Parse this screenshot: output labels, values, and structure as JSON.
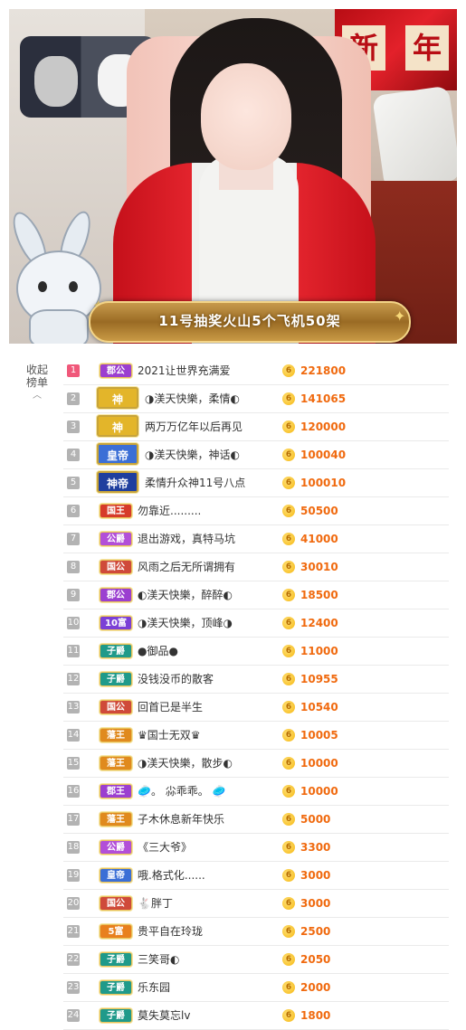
{
  "stream": {
    "banner_text": "11号抽奖火山5个飞机50架",
    "lantern_chars": [
      "新",
      "年"
    ]
  },
  "ranking": {
    "collapse_label": "收起榜单",
    "coin_glyph": "6",
    "rows": [
      {
        "rank": "1",
        "badge": "郡公",
        "badge_color": "#9b3fd0",
        "big": false,
        "name": "2021让世界充满爱",
        "score": "221800"
      },
      {
        "rank": "2",
        "badge": "神",
        "badge_color": "#e3b52a",
        "big": true,
        "name": "◑渼天快樂，柔情◐",
        "score": "141065"
      },
      {
        "rank": "3",
        "badge": "神",
        "badge_color": "#e3b52a",
        "big": true,
        "name": "两万万亿年以后再见",
        "score": "120000"
      },
      {
        "rank": "4",
        "badge": "皇帝",
        "badge_color": "#3b6fd6",
        "big": true,
        "name": "◑渼天快樂，神话◐",
        "score": "100040"
      },
      {
        "rank": "5",
        "badge": "神帝",
        "badge_color": "#1f3f9e",
        "big": true,
        "name": "柔情升众神11号八点",
        "score": "100010"
      },
      {
        "rank": "6",
        "badge": "国王",
        "badge_color": "#d63a2a",
        "big": false,
        "name": "勿靠近.........",
        "score": "50500"
      },
      {
        "rank": "7",
        "badge": "公爵",
        "badge_color": "#b24fd8",
        "big": false,
        "name": "退出游戏，真特马坑",
        "score": "41000"
      },
      {
        "rank": "8",
        "badge": "国公",
        "badge_color": "#cf4a3a",
        "big": false,
        "name": "风雨之后无所谓拥有",
        "score": "30010"
      },
      {
        "rank": "9",
        "badge": "郡公",
        "badge_color": "#9b3fd0",
        "big": false,
        "name": "◐渼天快樂，醉醉◐",
        "score": "18500"
      },
      {
        "rank": "10",
        "badge": "10富",
        "badge_color": "#7b3fd6",
        "big": false,
        "name": "◑渼天快樂，顶峰◑",
        "score": "12400"
      },
      {
        "rank": "11",
        "badge": "子爵",
        "badge_color": "#1f9a8a",
        "big": false,
        "name": "●御品●",
        "score": "11000"
      },
      {
        "rank": "12",
        "badge": "子爵",
        "badge_color": "#1f9a8a",
        "big": false,
        "name": "没钱没币的散客",
        "score": "10955"
      },
      {
        "rank": "13",
        "badge": "国公",
        "badge_color": "#cf4a3a",
        "big": false,
        "name": "回首已是半生",
        "score": "10540"
      },
      {
        "rank": "14",
        "badge": "藩王",
        "badge_color": "#e08a1e",
        "big": false,
        "name": "♛国士无双♛",
        "score": "10005"
      },
      {
        "rank": "15",
        "badge": "藩王",
        "badge_color": "#e08a1e",
        "big": false,
        "name": "◑渼天快樂，散步◐",
        "score": "10000"
      },
      {
        "rank": "16",
        "badge": "郡王",
        "badge_color": "#9b3fd0",
        "big": false,
        "name": "🥏。 尛乖乖。 🥏",
        "score": "10000"
      },
      {
        "rank": "17",
        "badge": "藩王",
        "badge_color": "#e08a1e",
        "big": false,
        "name": "子木休息新年快乐",
        "score": "5000"
      },
      {
        "rank": "18",
        "badge": "公爵",
        "badge_color": "#b24fd8",
        "big": false,
        "name": "《三大爷》",
        "score": "3300"
      },
      {
        "rank": "19",
        "badge": "皇帝",
        "badge_color": "#3b6fd6",
        "big": false,
        "name": "哦.格式化......",
        "score": "3000"
      },
      {
        "rank": "20",
        "badge": "国公",
        "badge_color": "#cf4a3a",
        "big": false,
        "name": "🐇胖丁",
        "score": "3000"
      },
      {
        "rank": "21",
        "badge": "5富",
        "badge_color": "#e8801e",
        "big": false,
        "name": "贵平自在玲珑",
        "score": "2500"
      },
      {
        "rank": "22",
        "badge": "子爵",
        "badge_color": "#1f9a8a",
        "big": false,
        "name": "三笑哥◐",
        "score": "2050"
      },
      {
        "rank": "23",
        "badge": "子爵",
        "badge_color": "#1f9a8a",
        "big": false,
        "name": "乐东园",
        "score": "2000"
      },
      {
        "rank": "24",
        "badge": "子爵",
        "badge_color": "#1f9a8a",
        "big": false,
        "name": "莫失莫忘lv",
        "score": "1800"
      }
    ]
  }
}
